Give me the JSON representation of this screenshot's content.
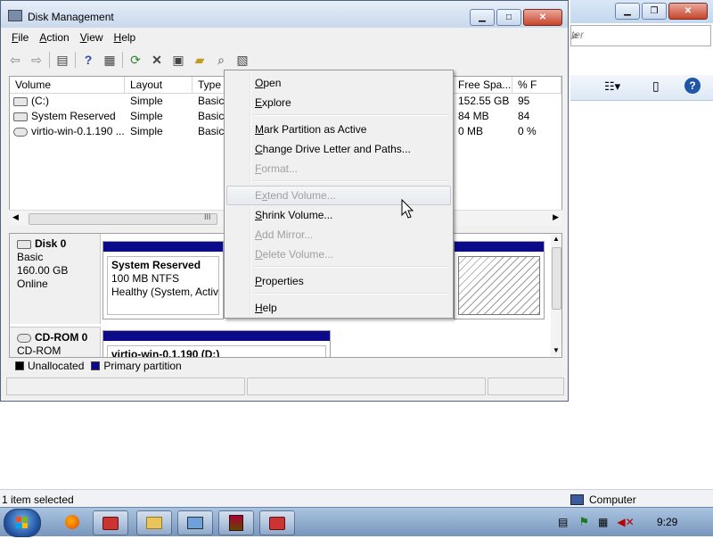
{
  "background_window": {
    "search_placeholder": "ter",
    "status_left": "1 item selected",
    "status_right": "Computer"
  },
  "window": {
    "title": "Disk Management"
  },
  "menubar": [
    {
      "label": "File",
      "mnemonic": "F",
      "rest": "ile"
    },
    {
      "label": "Action",
      "mnemonic": "A",
      "rest": "ction"
    },
    {
      "label": "View",
      "mnemonic": "V",
      "rest": "iew"
    },
    {
      "label": "Help",
      "mnemonic": "H",
      "rest": "elp"
    }
  ],
  "toolbar_icons": [
    "back-arrow-icon",
    "forward-arrow-icon",
    "console-tree-icon",
    "help-icon",
    "properties-icon",
    "refresh-icon",
    "delete-icon",
    "settings-icon",
    "open-folder-icon",
    "search-icon",
    "disk-icon"
  ],
  "volume_list": {
    "columns": [
      "Volume",
      "Layout",
      "Type",
      "Free Spa...",
      "% F"
    ],
    "rows": [
      {
        "volume": "(C:)",
        "layout": "Simple",
        "type": "Basic",
        "free": "152.55 GB",
        "pct": "95"
      },
      {
        "volume": "System Reserved",
        "layout": "Simple",
        "type": "Basic",
        "free": "84 MB",
        "pct": "84"
      },
      {
        "volume": "virtio-win-0.1.190 ...",
        "layout": "Simple",
        "type": "Basic",
        "free": "0 MB",
        "pct": "0 %"
      }
    ],
    "scroll_marker": "III"
  },
  "disks": [
    {
      "name": "Disk 0",
      "type": "Basic",
      "size": "160.00 GB",
      "status": "Online",
      "partition": {
        "name": "System Reserved",
        "detail": "100 MB NTFS",
        "health": "Healthy (System, Active"
      }
    },
    {
      "name": "CD-ROM 0",
      "type": "CD-ROM",
      "partition": {
        "name": "virtio-win-0.1.190 (D:)"
      }
    }
  ],
  "legend": [
    {
      "label": "Unallocated",
      "color": "#000000"
    },
    {
      "label": "Primary partition",
      "color": "#0a0a8a"
    }
  ],
  "context_menu": [
    {
      "label": "Open",
      "mnemonic": "O",
      "rest": "pen",
      "enabled": true
    },
    {
      "label": "Explore",
      "mnemonic": "E",
      "rest": "xplore",
      "enabled": true
    },
    {
      "label": "Mark Partition as Active",
      "mnemonic": "M",
      "rest": "ark Partition as Active",
      "enabled": true
    },
    {
      "label": "Change Drive Letter and Paths...",
      "mnemonic": "C",
      "rest": "hange Drive Letter and Paths...",
      "enabled": true
    },
    {
      "label": "Format...",
      "mnemonic": "F",
      "rest": "ormat...",
      "enabled": false
    },
    {
      "label": "Extend Volume...",
      "mnemonic": "x",
      "pre": "E",
      "rest": "tend Volume...",
      "enabled": false,
      "hover": true
    },
    {
      "label": "Shrink Volume...",
      "mnemonic": "S",
      "rest": "hrink Volume...",
      "enabled": true
    },
    {
      "label": "Add Mirror...",
      "mnemonic": "A",
      "rest": "dd Mirror...",
      "enabled": false
    },
    {
      "label": "Delete Volume...",
      "mnemonic": "D",
      "rest": "elete Volume...",
      "enabled": false
    },
    {
      "label": "Properties",
      "mnemonic": "P",
      "rest": "roperties",
      "enabled": true
    },
    {
      "label": "Help",
      "mnemonic": "H",
      "rest": "elp",
      "enabled": true
    }
  ],
  "taskbar": {
    "clock": "9:29",
    "apps": [
      "firefox-icon",
      "toolbox-icon",
      "folder-icon",
      "remote-desktop-icon",
      "archive-icon",
      "toolbox-icon"
    ]
  }
}
